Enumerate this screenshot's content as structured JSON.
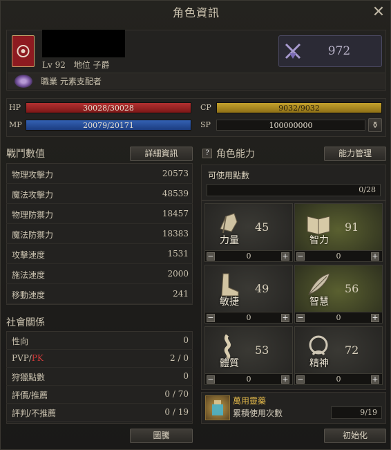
{
  "window": {
    "title": "角色資訊"
  },
  "profile": {
    "level_prefix": "Lv",
    "level": "92",
    "rank_label": "地位",
    "rank_value": "子爵",
    "job_label": "職業",
    "job_value": "元素支配者",
    "combat_power": "972"
  },
  "resources": {
    "hp_label": "HP",
    "hp_value": "30028/30028",
    "mp_label": "MP",
    "mp_value": "20079/20171",
    "cp_label": "CP",
    "cp_value": "9032/9032",
    "sp_label": "SP",
    "sp_value": "100000000"
  },
  "combat": {
    "heading": "戰鬥數值",
    "detail_button": "詳細資訊",
    "rows": [
      {
        "label": "物理攻擊力",
        "value": "20573"
      },
      {
        "label": "魔法攻擊力",
        "value": "48539"
      },
      {
        "label": "物理防禦力",
        "value": "18457"
      },
      {
        "label": "魔法防禦力",
        "value": "18383"
      },
      {
        "label": "攻擊速度",
        "value": "1531"
      },
      {
        "label": "施法速度",
        "value": "2000"
      },
      {
        "label": "移動速度",
        "value": "241"
      }
    ]
  },
  "social": {
    "heading": "社會關係",
    "rows": [
      {
        "label": "性向",
        "value": "0"
      },
      {
        "label_a": "PVP/",
        "label_b": "PK",
        "value": "2 / 0"
      },
      {
        "label": "狩獵點數",
        "value": "0"
      },
      {
        "label": "評價/推薦",
        "value": "0 / 70"
      },
      {
        "label": "評判/不推薦",
        "value": "0 / 19"
      }
    ],
    "emblem_button": "圖騰"
  },
  "ability": {
    "help_icon": "?",
    "heading": "角色能力",
    "manage_button": "能力管理",
    "points_label": "可使用點數",
    "points_value": "0/28",
    "stats": [
      {
        "name": "力量",
        "value": "45",
        "add": "0",
        "icon": "fist-icon",
        "style": "dark"
      },
      {
        "name": "智力",
        "value": "91",
        "add": "0",
        "icon": "book-icon",
        "style": "green"
      },
      {
        "name": "敏捷",
        "value": "49",
        "add": "0",
        "icon": "foot-icon",
        "style": "dark"
      },
      {
        "name": "智慧",
        "value": "56",
        "add": "0",
        "icon": "feather-icon",
        "style": "green"
      },
      {
        "name": "體質",
        "value": "53",
        "add": "0",
        "icon": "spine-icon",
        "style": "dark"
      },
      {
        "name": "精神",
        "value": "72",
        "add": "0",
        "icon": "mind-icon",
        "style": "dark"
      }
    ],
    "elixir_name": "萬用靈藥",
    "elixir_label": "累積使用次數",
    "elixir_value": "9/19",
    "reset_button": "初始化"
  },
  "colors": {
    "hp": "#9a2424",
    "mp": "#2a55a8",
    "cp": "#b8921f",
    "pk": "#d23b3b",
    "elixir": "#e2b84a"
  }
}
